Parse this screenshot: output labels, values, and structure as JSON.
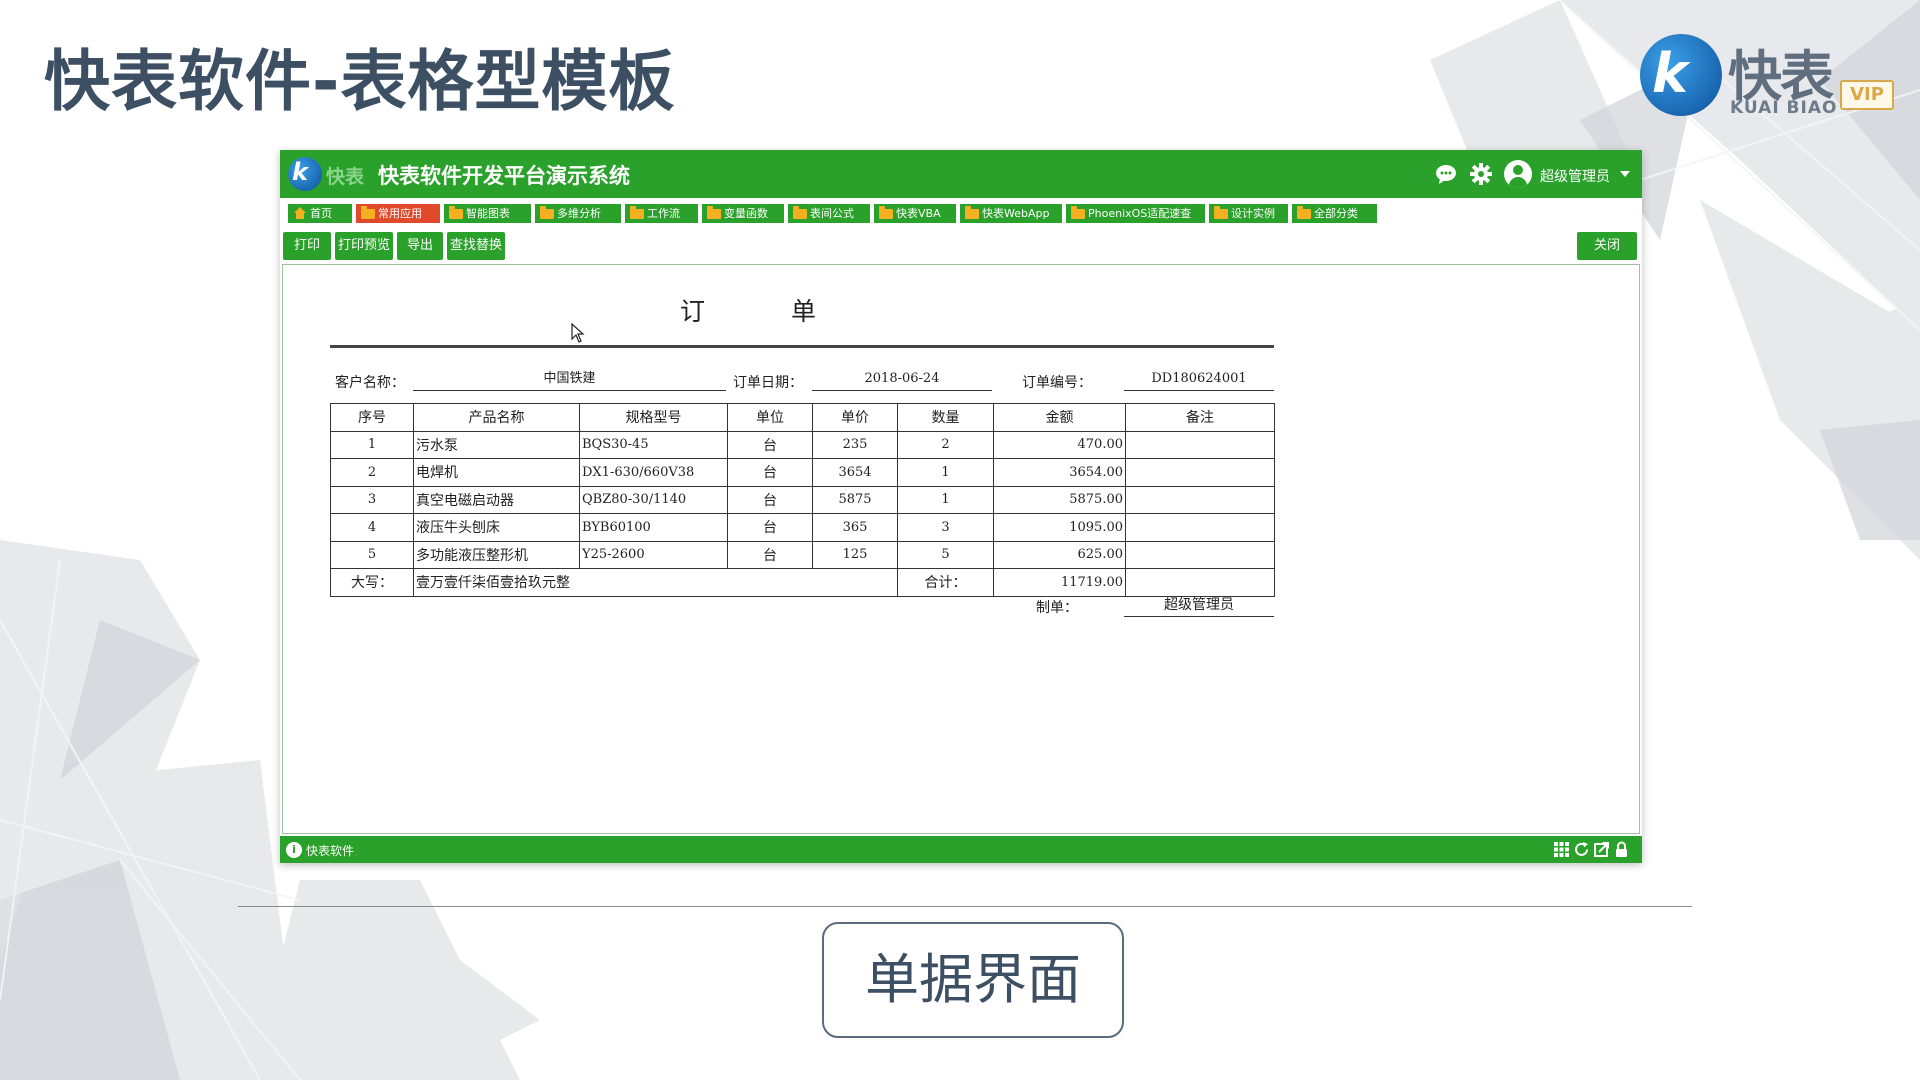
{
  "slide": {
    "title": "快表软件-表格型模板",
    "caption": "单据界面",
    "logo": {
      "mark": "k",
      "cn": "快表",
      "en": "KUAI BIAO",
      "vip": "VIP"
    }
  },
  "app": {
    "logo_text": "快表",
    "title": "快表软件开发平台演示系统",
    "user_name": "超级管理员",
    "nav_tabs": [
      {
        "label": "首页",
        "icon": "home-icon"
      },
      {
        "label": "常用应用",
        "icon": "folder-icon",
        "active": true
      },
      {
        "label": "智能图表",
        "icon": "folder-icon"
      },
      {
        "label": "多维分析",
        "icon": "folder-icon"
      },
      {
        "label": "工作流",
        "icon": "folder-icon"
      },
      {
        "label": "变量函数",
        "icon": "folder-icon"
      },
      {
        "label": "表间公式",
        "icon": "folder-icon"
      },
      {
        "label": "快表VBA",
        "icon": "folder-icon"
      },
      {
        "label": "快表WebApp",
        "icon": "folder-icon"
      },
      {
        "label": "PhoenixOS适配速查",
        "icon": "folder-icon"
      },
      {
        "label": "设计实例",
        "icon": "folder-icon"
      },
      {
        "label": "全部分类",
        "icon": "folder-icon"
      }
    ],
    "toolbar": {
      "print": "打印",
      "print_preview": "打印预览",
      "export": "导出",
      "find_replace": "查找替换",
      "close": "关闭"
    },
    "status_text": "快表软件",
    "colors": {
      "primary": "#2aa12a",
      "active_tab": "#e04a2a",
      "folder": "#f5b021"
    }
  },
  "form": {
    "title": "订单",
    "customer_label": "客户名称：",
    "customer_value": "中国铁建",
    "date_label": "订单日期：",
    "date_value": "2018-06-24",
    "number_label": "订单编号：",
    "number_value": "DD180624001",
    "columns": [
      "序号",
      "产品名称",
      "规格型号",
      "单位",
      "单价",
      "数量",
      "金额",
      "备注"
    ],
    "rows": [
      {
        "no": "1",
        "name": "污水泵",
        "spec": "BQS30-45",
        "unit": "台",
        "price": "235",
        "qty": "2",
        "amount": "470.00",
        "note": ""
      },
      {
        "no": "2",
        "name": "电焊机",
        "spec": "DX1-630/660V38",
        "unit": "台",
        "price": "3654",
        "qty": "1",
        "amount": "3654.00",
        "note": ""
      },
      {
        "no": "3",
        "name": "真空电磁启动器",
        "spec": "QBZ80-30/1140",
        "unit": "台",
        "price": "5875",
        "qty": "1",
        "amount": "5875.00",
        "note": ""
      },
      {
        "no": "4",
        "name": "液压牛头刨床",
        "spec": "BYB60100",
        "unit": "台",
        "price": "365",
        "qty": "3",
        "amount": "1095.00",
        "note": ""
      },
      {
        "no": "5",
        "name": "多功能液压整形机",
        "spec": "Y25-2600",
        "unit": "台",
        "price": "125",
        "qty": "5",
        "amount": "625.00",
        "note": ""
      }
    ],
    "capital_label": "大写：",
    "capital_value": "壹万壹仟柒佰壹拾玖元整",
    "total_label": "合计：",
    "total_value": "11719.00",
    "maker_label": "制单：",
    "maker_value": "超级管理员"
  }
}
